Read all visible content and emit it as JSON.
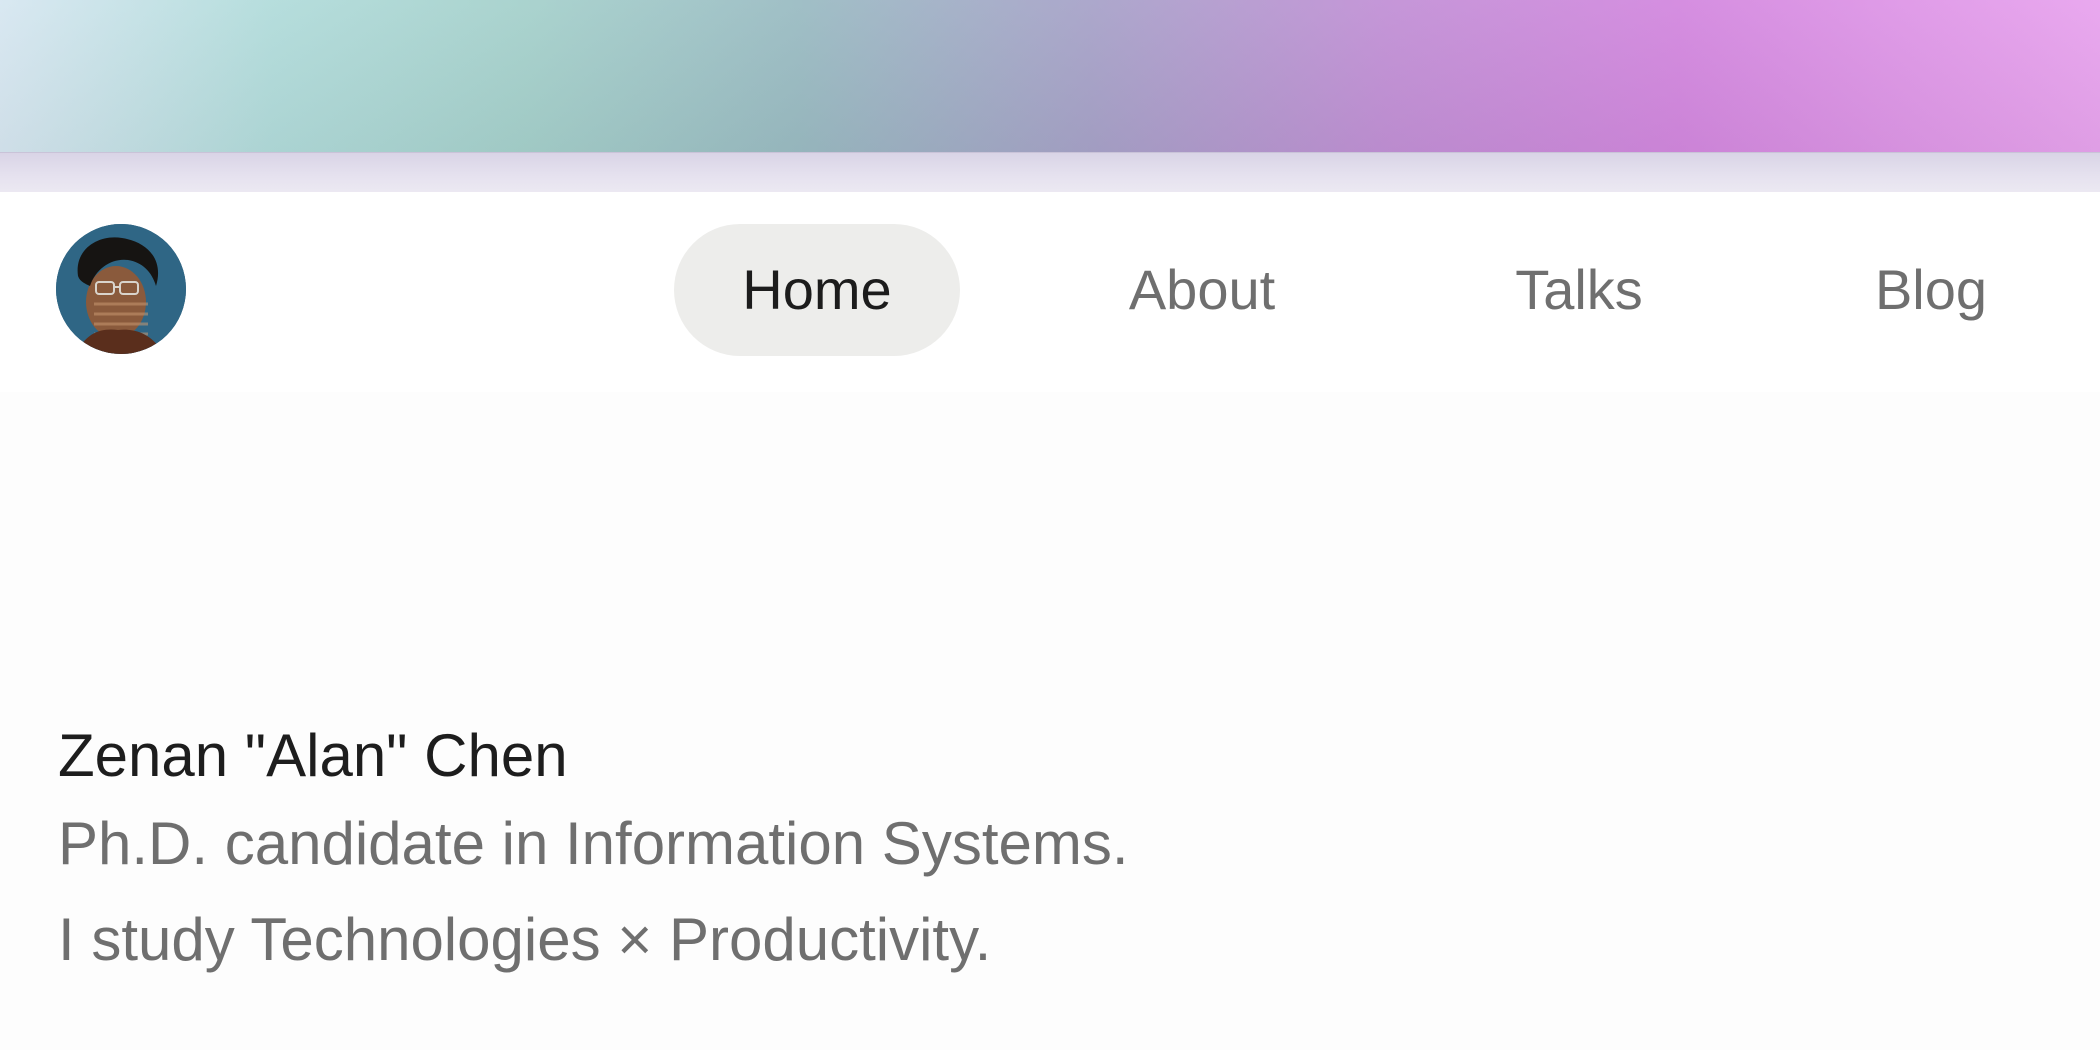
{
  "nav": {
    "items": [
      {
        "label": "Home",
        "active": true
      },
      {
        "label": "About",
        "active": false
      },
      {
        "label": "Talks",
        "active": false
      },
      {
        "label": "Blog",
        "active": false
      }
    ]
  },
  "intro": {
    "name": "Zenan \"Alan\" Chen",
    "line1": "Ph.D. candidate in Information Systems.",
    "line2": "I study Technologies × Productivity."
  },
  "colors": {
    "active_pill": "#ededeb",
    "text_primary": "#1c1c1c",
    "text_secondary": "#6f6f6f"
  }
}
